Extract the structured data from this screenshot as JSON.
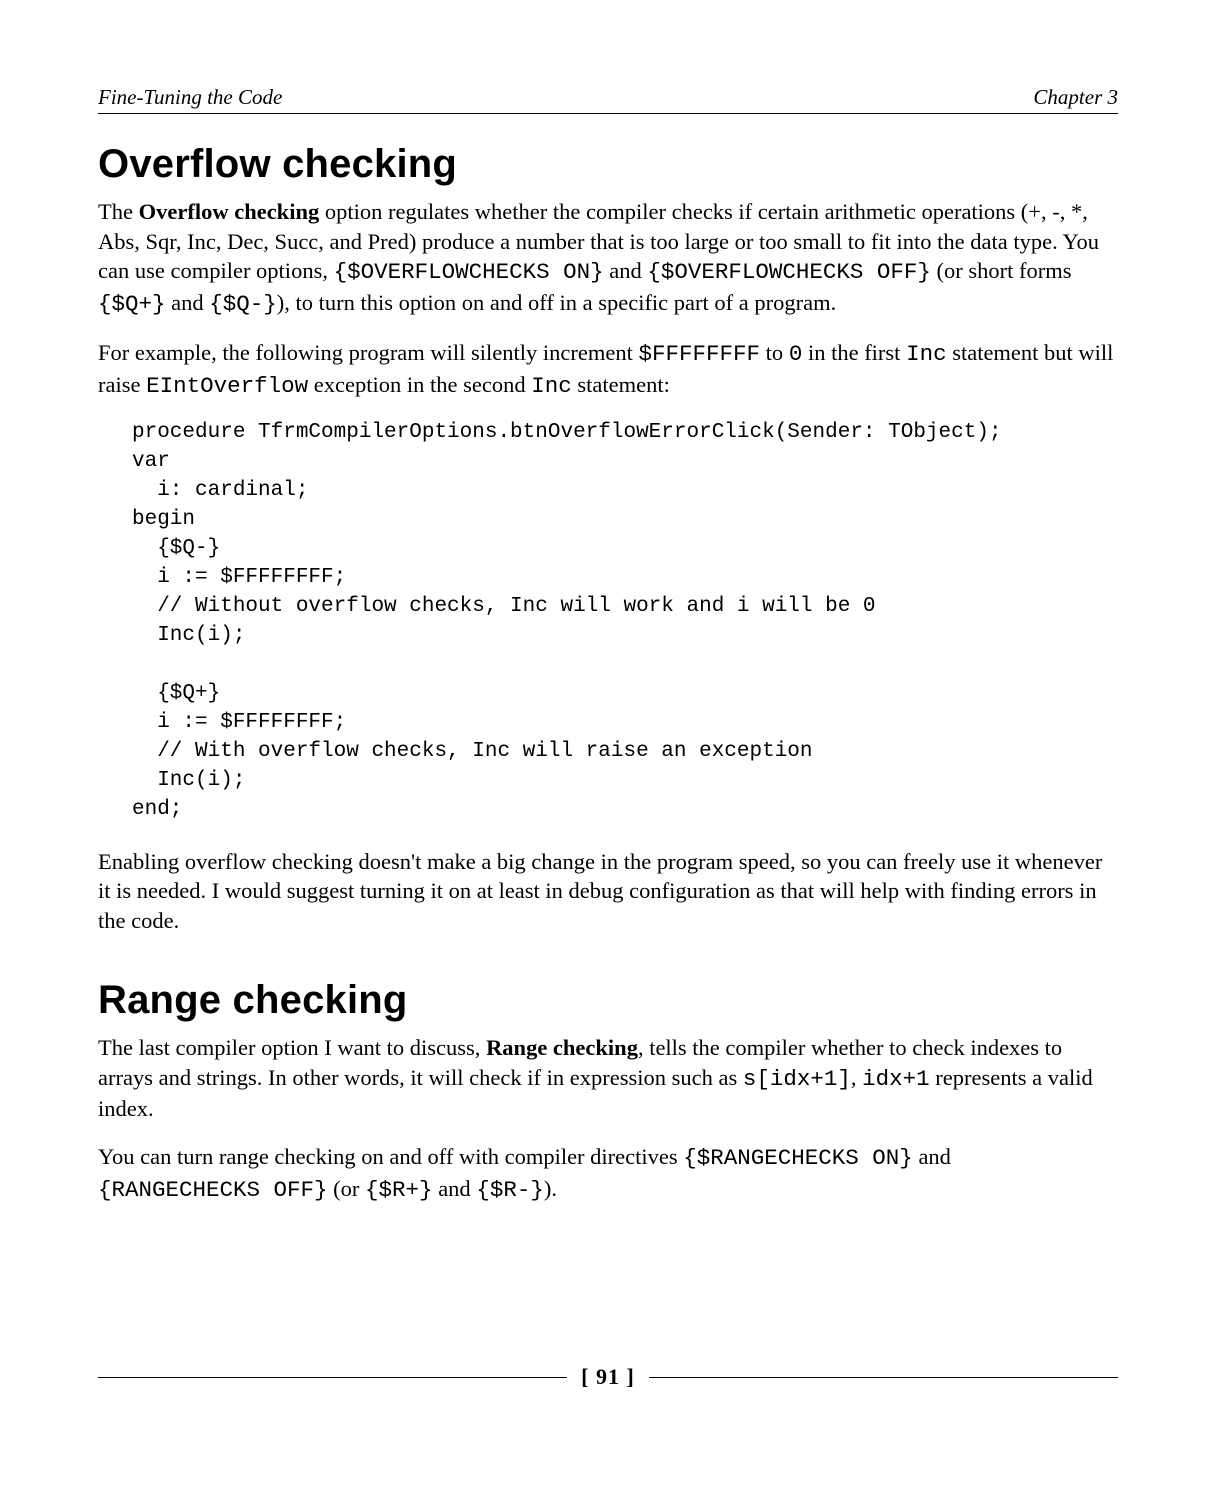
{
  "header": {
    "left": "Fine-Tuning the Code",
    "right": "Chapter 3"
  },
  "sections": {
    "overflow": {
      "title": "Overflow checking",
      "para1_a": "The ",
      "para1_bold": "Overflow checking",
      "para1_b": " option regulates whether the compiler checks if certain arithmetic operations (+, -, *, Abs, Sqr, Inc, Dec, Succ, and Pred) produce a number that is too large or too small to fit into the data type. You can use compiler options, ",
      "para1_m1": "{$OVERFLOWCHECKS ON}",
      "para1_c": " and ",
      "para1_m2": "{$OVERFLOWCHECKS OFF}",
      "para1_d": " (or short forms ",
      "para1_m3": "{$Q+}",
      "para1_e": " and ",
      "para1_m4": "{$Q-}",
      "para1_f": "), to turn this option on and off in a specific part of a program.",
      "para2_a": "For example, the following program will silently increment ",
      "para2_m1": "$FFFFFFFF",
      "para2_b": " to ",
      "para2_m2": "0",
      "para2_c": " in the first ",
      "para2_m3": "Inc",
      "para2_d": " statement but will raise ",
      "para2_m4": "EIntOverflow",
      "para2_e": " exception in the second ",
      "para2_m5": "Inc",
      "para2_f": " statement:",
      "code": "procedure TfrmCompilerOptions.btnOverflowErrorClick(Sender: TObject);\nvar\n  i: cardinal;\nbegin\n  {$Q-}\n  i := $FFFFFFFF;\n  // Without overflow checks, Inc will work and i will be 0\n  Inc(i);\n\n  {$Q+}\n  i := $FFFFFFFF;\n  // With overflow checks, Inc will raise an exception\n  Inc(i);\nend;",
      "para3": "Enabling overflow checking doesn't make a big change in the program speed, so you can freely use it whenever it is needed. I would suggest turning it on at least in debug configuration as that will help with finding errors in the code."
    },
    "range": {
      "title": "Range checking",
      "para1_a": "The last compiler option I want to discuss, ",
      "para1_bold": "Range checking",
      "para1_b": ", tells the compiler whether to check indexes to arrays and strings. In other words, it will check if in expression such as ",
      "para1_m1": "s[idx+1]",
      "para1_c": ", ",
      "para1_m2": "idx+1",
      "para1_d": " represents a valid index.",
      "para2_a": "You can turn range checking on and off with compiler directives ",
      "para2_m1": "{$RANGECHECKS ON}",
      "para2_b": " and ",
      "para2_m2": "{RANGECHECKS OFF}",
      "para2_c": " (or ",
      "para2_m3": "{$R+}",
      "para2_d": " and ",
      "para2_m4": "{$R-}",
      "para2_e": ")."
    }
  },
  "page_number": "[ 91 ]"
}
